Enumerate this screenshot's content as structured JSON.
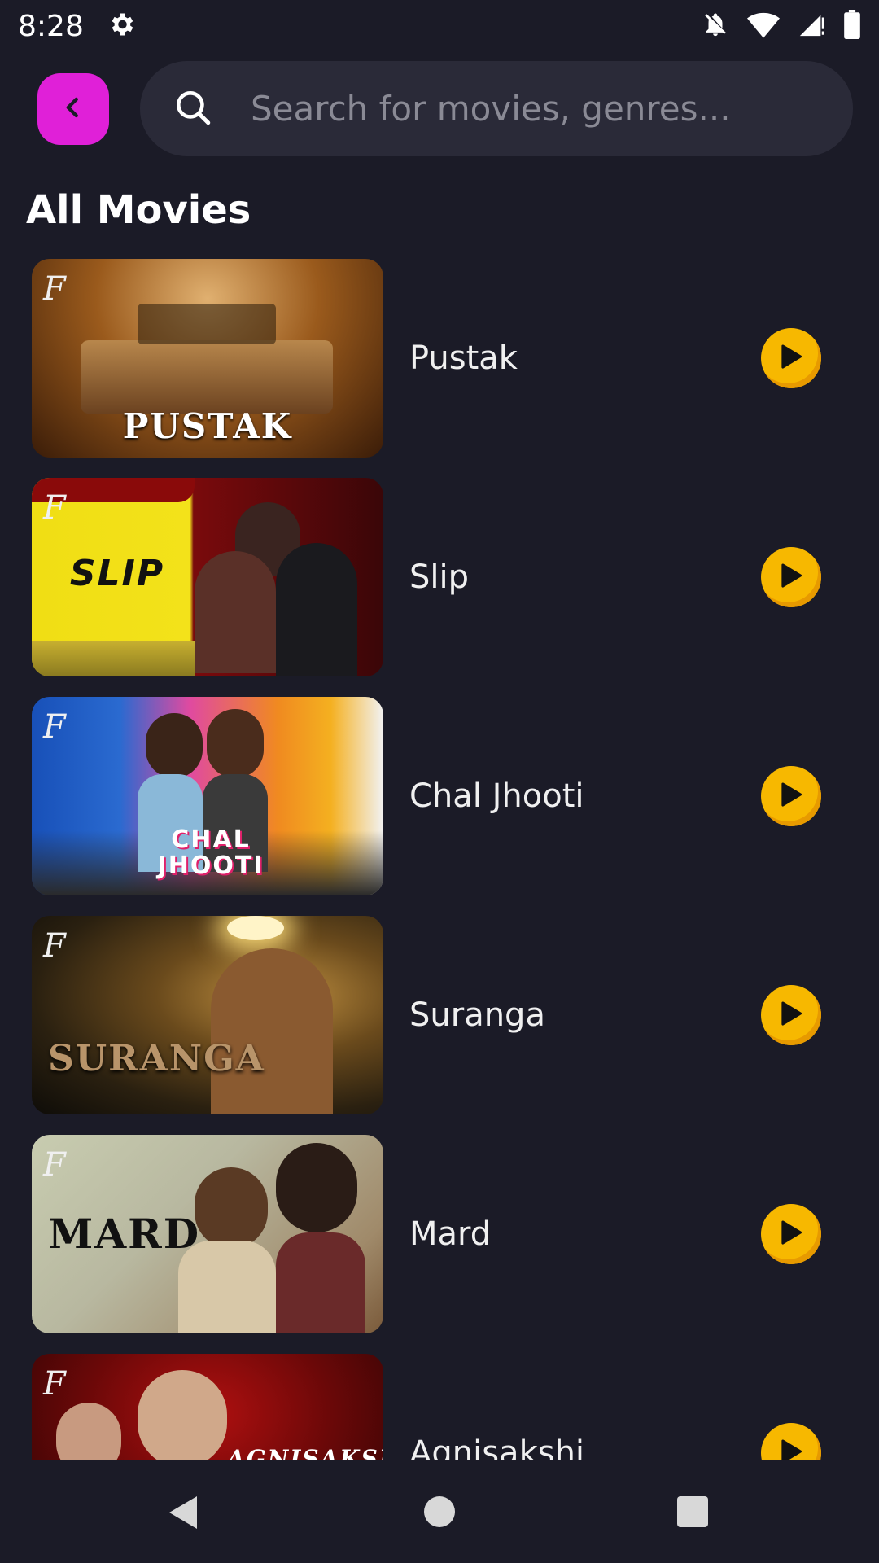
{
  "status_bar": {
    "time": "8:28",
    "icons": [
      "settings-icon",
      "notifications-off-icon",
      "wifi-icon",
      "signal-icon",
      "battery-icon"
    ]
  },
  "header": {
    "back_icon": "chevron-left-icon",
    "search": {
      "icon": "search-icon",
      "placeholder": "Search for movies, genres..."
    }
  },
  "section_title": "All Movies",
  "movies": [
    {
      "title": "Pustak",
      "poster_text": "PUSTAK"
    },
    {
      "title": "Slip",
      "poster_text": "SLIP"
    },
    {
      "title": "Chal Jhooti",
      "poster_text": "CHAL JHOOTI"
    },
    {
      "title": "Suranga",
      "poster_text": "SURANGA"
    },
    {
      "title": "Mard",
      "poster_text": "MARD"
    },
    {
      "title": "Agnisakshi",
      "poster_text": "AGNISAKSHI"
    }
  ],
  "brand_logo": "F",
  "colors": {
    "background": "#1b1b27",
    "accent_pink": "#e020d8",
    "play_yellow": "#f7b800",
    "search_bg": "#2a2a38"
  },
  "nav_bar": {
    "icons": [
      "nav-back-icon",
      "nav-home-icon",
      "nav-recents-icon"
    ]
  }
}
